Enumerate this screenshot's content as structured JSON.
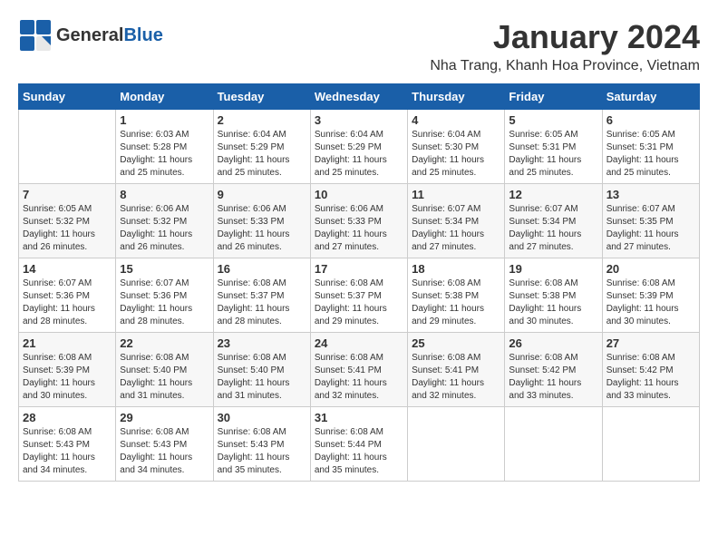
{
  "logo": {
    "general": "General",
    "blue": "Blue"
  },
  "title": "January 2024",
  "location": "Nha Trang, Khanh Hoa Province, Vietnam",
  "weekdays": [
    "Sunday",
    "Monday",
    "Tuesday",
    "Wednesday",
    "Thursday",
    "Friday",
    "Saturday"
  ],
  "weeks": [
    [
      {
        "day": "",
        "info": ""
      },
      {
        "day": "1",
        "info": "Sunrise: 6:03 AM\nSunset: 5:28 PM\nDaylight: 11 hours\nand 25 minutes."
      },
      {
        "day": "2",
        "info": "Sunrise: 6:04 AM\nSunset: 5:29 PM\nDaylight: 11 hours\nand 25 minutes."
      },
      {
        "day": "3",
        "info": "Sunrise: 6:04 AM\nSunset: 5:29 PM\nDaylight: 11 hours\nand 25 minutes."
      },
      {
        "day": "4",
        "info": "Sunrise: 6:04 AM\nSunset: 5:30 PM\nDaylight: 11 hours\nand 25 minutes."
      },
      {
        "day": "5",
        "info": "Sunrise: 6:05 AM\nSunset: 5:31 PM\nDaylight: 11 hours\nand 25 minutes."
      },
      {
        "day": "6",
        "info": "Sunrise: 6:05 AM\nSunset: 5:31 PM\nDaylight: 11 hours\nand 25 minutes."
      }
    ],
    [
      {
        "day": "7",
        "info": "Sunrise: 6:05 AM\nSunset: 5:32 PM\nDaylight: 11 hours\nand 26 minutes."
      },
      {
        "day": "8",
        "info": "Sunrise: 6:06 AM\nSunset: 5:32 PM\nDaylight: 11 hours\nand 26 minutes."
      },
      {
        "day": "9",
        "info": "Sunrise: 6:06 AM\nSunset: 5:33 PM\nDaylight: 11 hours\nand 26 minutes."
      },
      {
        "day": "10",
        "info": "Sunrise: 6:06 AM\nSunset: 5:33 PM\nDaylight: 11 hours\nand 27 minutes."
      },
      {
        "day": "11",
        "info": "Sunrise: 6:07 AM\nSunset: 5:34 PM\nDaylight: 11 hours\nand 27 minutes."
      },
      {
        "day": "12",
        "info": "Sunrise: 6:07 AM\nSunset: 5:34 PM\nDaylight: 11 hours\nand 27 minutes."
      },
      {
        "day": "13",
        "info": "Sunrise: 6:07 AM\nSunset: 5:35 PM\nDaylight: 11 hours\nand 27 minutes."
      }
    ],
    [
      {
        "day": "14",
        "info": "Sunrise: 6:07 AM\nSunset: 5:36 PM\nDaylight: 11 hours\nand 28 minutes."
      },
      {
        "day": "15",
        "info": "Sunrise: 6:07 AM\nSunset: 5:36 PM\nDaylight: 11 hours\nand 28 minutes."
      },
      {
        "day": "16",
        "info": "Sunrise: 6:08 AM\nSunset: 5:37 PM\nDaylight: 11 hours\nand 28 minutes."
      },
      {
        "day": "17",
        "info": "Sunrise: 6:08 AM\nSunset: 5:37 PM\nDaylight: 11 hours\nand 29 minutes."
      },
      {
        "day": "18",
        "info": "Sunrise: 6:08 AM\nSunset: 5:38 PM\nDaylight: 11 hours\nand 29 minutes."
      },
      {
        "day": "19",
        "info": "Sunrise: 6:08 AM\nSunset: 5:38 PM\nDaylight: 11 hours\nand 30 minutes."
      },
      {
        "day": "20",
        "info": "Sunrise: 6:08 AM\nSunset: 5:39 PM\nDaylight: 11 hours\nand 30 minutes."
      }
    ],
    [
      {
        "day": "21",
        "info": "Sunrise: 6:08 AM\nSunset: 5:39 PM\nDaylight: 11 hours\nand 30 minutes."
      },
      {
        "day": "22",
        "info": "Sunrise: 6:08 AM\nSunset: 5:40 PM\nDaylight: 11 hours\nand 31 minutes."
      },
      {
        "day": "23",
        "info": "Sunrise: 6:08 AM\nSunset: 5:40 PM\nDaylight: 11 hours\nand 31 minutes."
      },
      {
        "day": "24",
        "info": "Sunrise: 6:08 AM\nSunset: 5:41 PM\nDaylight: 11 hours\nand 32 minutes."
      },
      {
        "day": "25",
        "info": "Sunrise: 6:08 AM\nSunset: 5:41 PM\nDaylight: 11 hours\nand 32 minutes."
      },
      {
        "day": "26",
        "info": "Sunrise: 6:08 AM\nSunset: 5:42 PM\nDaylight: 11 hours\nand 33 minutes."
      },
      {
        "day": "27",
        "info": "Sunrise: 6:08 AM\nSunset: 5:42 PM\nDaylight: 11 hours\nand 33 minutes."
      }
    ],
    [
      {
        "day": "28",
        "info": "Sunrise: 6:08 AM\nSunset: 5:43 PM\nDaylight: 11 hours\nand 34 minutes."
      },
      {
        "day": "29",
        "info": "Sunrise: 6:08 AM\nSunset: 5:43 PM\nDaylight: 11 hours\nand 34 minutes."
      },
      {
        "day": "30",
        "info": "Sunrise: 6:08 AM\nSunset: 5:43 PM\nDaylight: 11 hours\nand 35 minutes."
      },
      {
        "day": "31",
        "info": "Sunrise: 6:08 AM\nSunset: 5:44 PM\nDaylight: 11 hours\nand 35 minutes."
      },
      {
        "day": "",
        "info": ""
      },
      {
        "day": "",
        "info": ""
      },
      {
        "day": "",
        "info": ""
      }
    ]
  ]
}
